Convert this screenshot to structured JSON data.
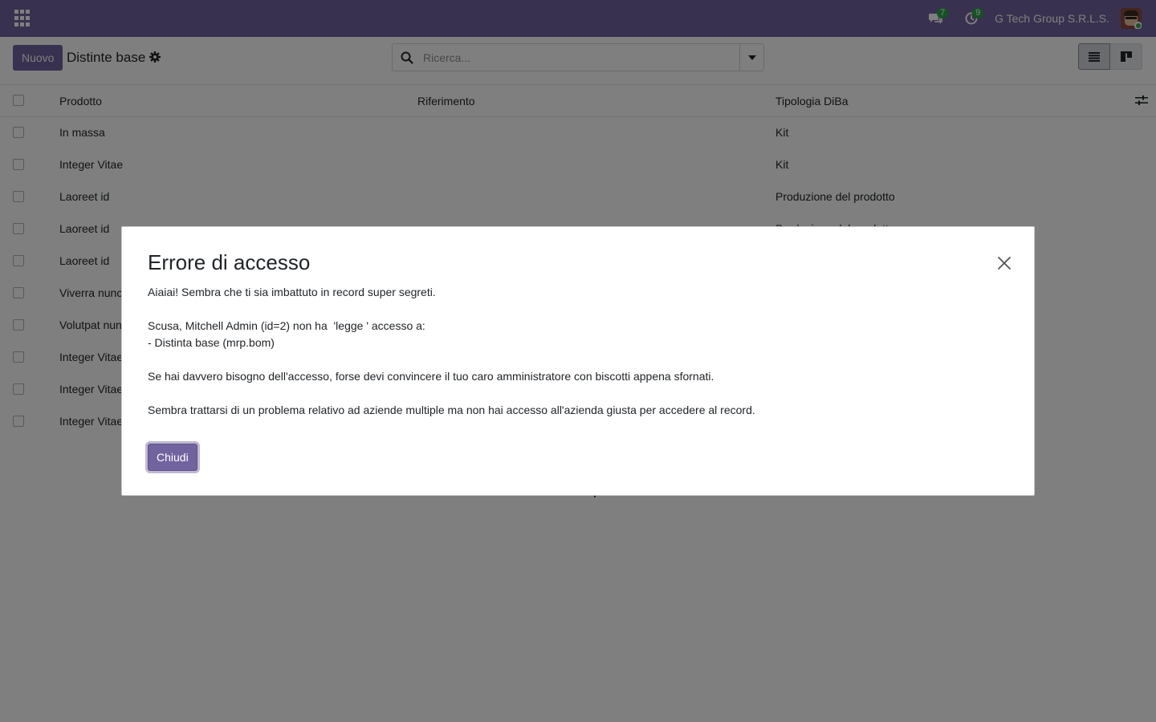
{
  "navbar": {
    "chat_count": "7",
    "activity_count": "9",
    "company": "G Tech Group S.R.L.S."
  },
  "control_panel": {
    "new_label": "Nuovo",
    "title": "Distinte base",
    "search_placeholder": "Ricerca..."
  },
  "list": {
    "columns": [
      "Prodotto",
      "Riferimento",
      "Tipologia DiBa"
    ],
    "rows": [
      {
        "product": "In massa",
        "reference": "",
        "type": "Kit"
      },
      {
        "product": "Integer Vitae",
        "reference": "",
        "type": "Kit"
      },
      {
        "product": "Laoreet id",
        "reference": "",
        "type": "Produzione del prodotto"
      },
      {
        "product": "Laoreet id",
        "reference": "",
        "type": "Produzione del prodotto"
      },
      {
        "product": "Laoreet id",
        "reference": "",
        "type": ""
      },
      {
        "product": "Viverra nunc",
        "reference": "",
        "type": ""
      },
      {
        "product": "Volutpat nunc",
        "reference": "",
        "type": ""
      },
      {
        "product": "Integer Vitae",
        "reference": "",
        "type": ""
      },
      {
        "product": "Integer Vitae",
        "reference": "",
        "type": ""
      },
      {
        "product": "Integer Vitae",
        "reference": "",
        "type": ""
      }
    ]
  },
  "dialog": {
    "title": "Errore di accesso",
    "line1": "Aiaiai! Sembra che ti sia imbattuto in record super segreti.",
    "line2": "Scusa, Mitchell Admin (id=2) non ha  'legge ' accesso a:",
    "line3": "- Distinta base (mrp.bom)",
    "line4": "Se hai davvero bisogno dell'accesso, forse devi convincere il tuo caro amministratore con biscotti appena sfornati.",
    "line5": "Sembra trattarsi di un problema relativo ad aziende multiple ma non hai accesso all'azienda giusta per accedere al record.",
    "close_label": "Chiudi"
  },
  "colors": {
    "brand": "#71639e",
    "badge": "#28a745"
  }
}
